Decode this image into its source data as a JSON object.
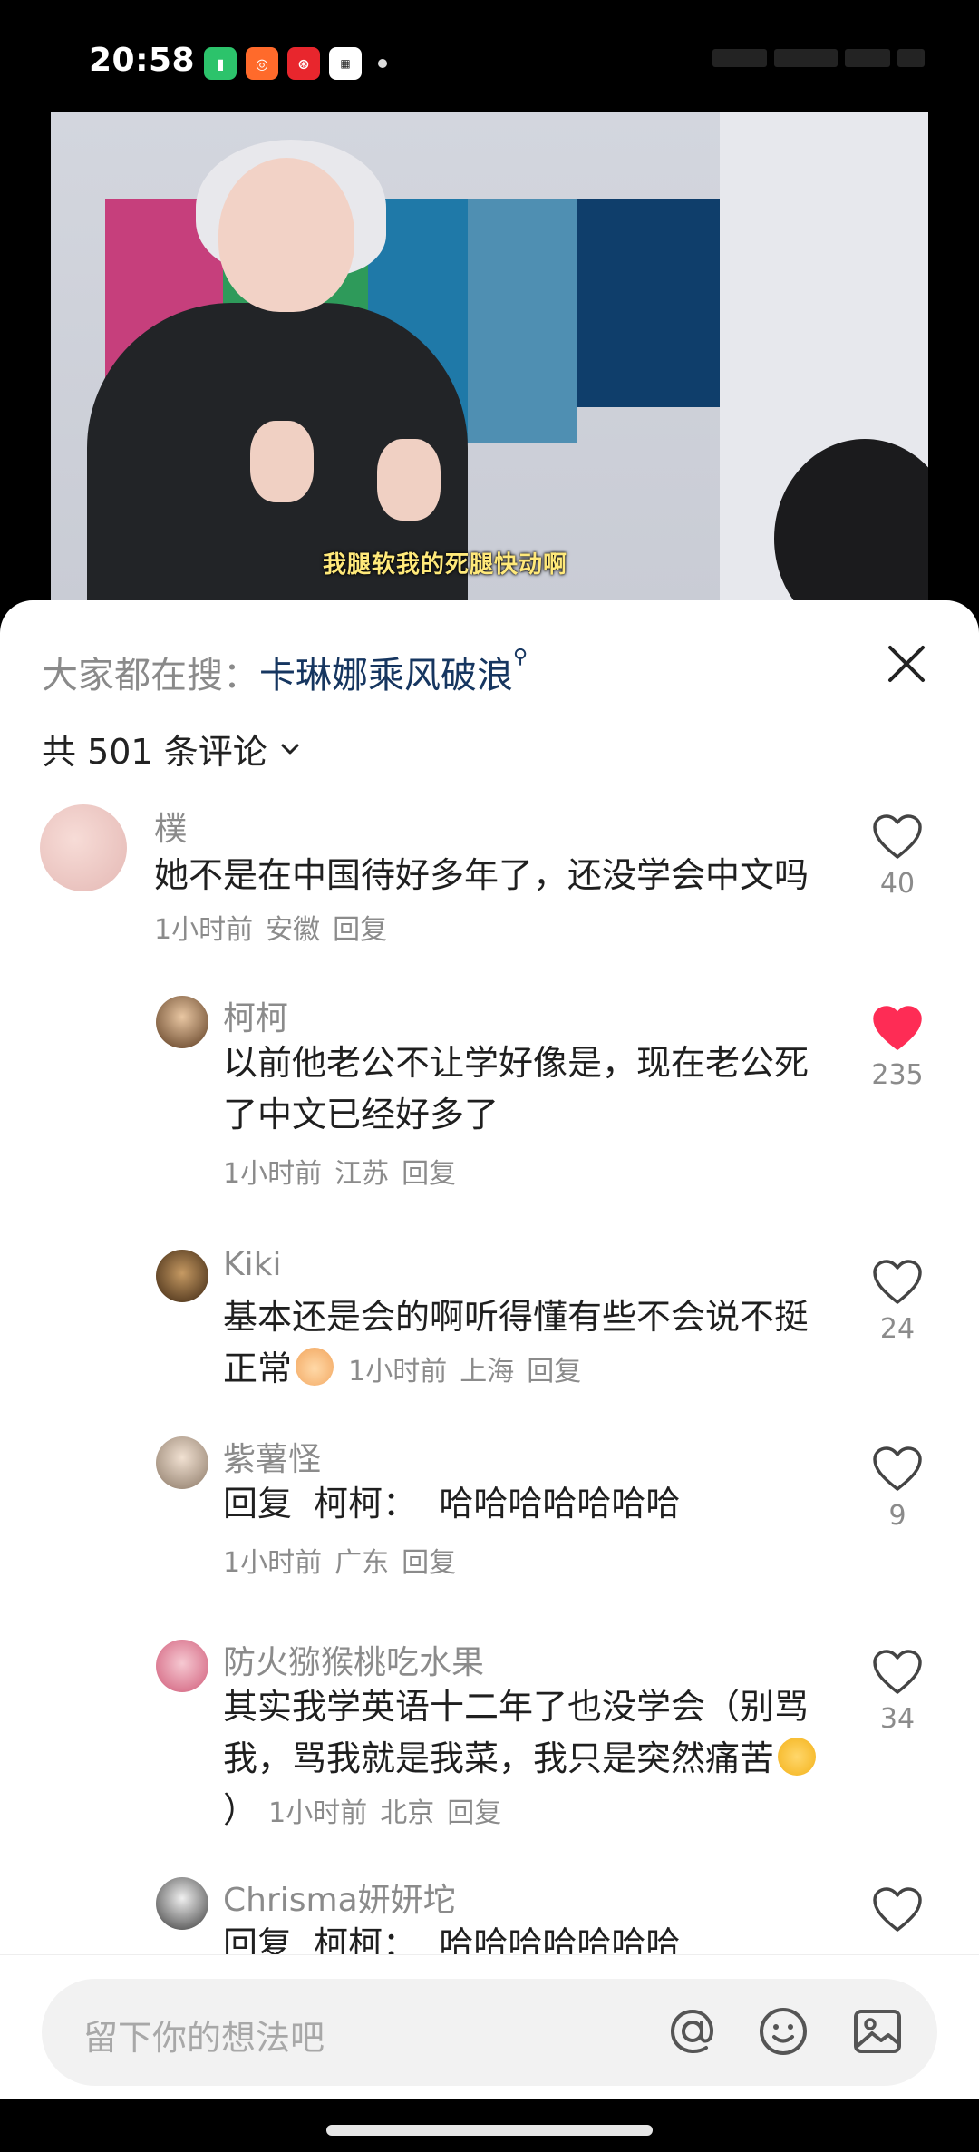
{
  "status_bar": {
    "time": "20:58"
  },
  "video": {
    "subtitle": "我腿软我的死腿快动啊"
  },
  "sheet": {
    "search_prefix": "大家都在搜：",
    "search_term": "卡琳娜乘风破浪",
    "comment_count": "共 501 条评论"
  },
  "comments": [
    {
      "name": "樸",
      "text": "她不是在中国待好多年了，还没学会中文吗",
      "time": "1小时前",
      "location": "安徽",
      "reply": "回复",
      "likes": "40",
      "liked": false
    },
    {
      "name": "柯柯",
      "text": "以前他老公不让学好像是，现在老公死了中文已经好多了",
      "time": "1小时前",
      "location": "江苏",
      "reply": "回复",
      "likes": "235",
      "liked": true
    },
    {
      "name": "Kiki",
      "text": "基本还是会的啊听得懂有些不会说不挺正常",
      "time": "1小时前",
      "location": "上海",
      "reply": "回复",
      "likes": "24",
      "liked": false
    },
    {
      "name": "紫薯怪",
      "text": "回复  柯柯：  哈哈哈哈哈哈哈",
      "time": "1小时前",
      "location": "广东",
      "reply": "回复",
      "likes": "9",
      "liked": false
    },
    {
      "name": "防火猕猴桃吃水果",
      "text": "其实我学英语十二年了也没学会（别骂我，骂我就是我菜，我只是突然痛苦",
      "text_end": "）",
      "time": "1小时前",
      "location": "北京",
      "reply": "回复",
      "likes": "34",
      "liked": false
    },
    {
      "name": "Chrisma妍妍坨",
      "text": "回复  柯柯：  哈哈哈哈哈哈哈"
    }
  ],
  "input": {
    "placeholder": "留下你的想法吧"
  },
  "icons": {
    "close": "close-icon",
    "chevron": "chevron-down-icon",
    "heart": "heart-icon",
    "at": "at-icon",
    "emoji": "emoji-icon",
    "image": "image-icon"
  },
  "colors": {
    "liked_heart": "#fe2c55",
    "search_term": "#163660",
    "muted_text": "#8b8b8b"
  }
}
